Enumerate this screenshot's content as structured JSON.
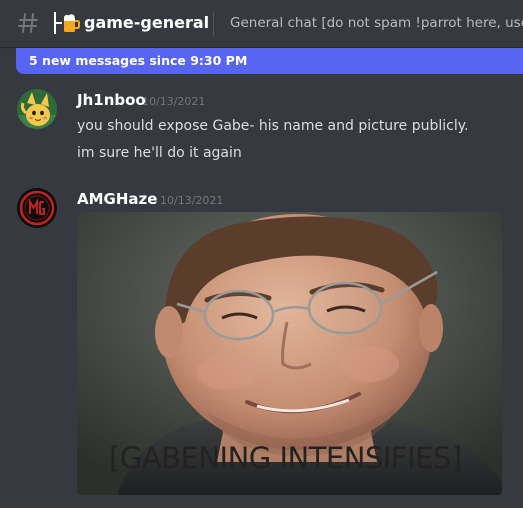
{
  "header": {
    "channel_name": "game-general",
    "topic": "General chat [do not spam !parrot here, use #p",
    "channel_icon": "hash-icon",
    "emoji_icon": "beer-mug-icon"
  },
  "new_messages_bar": {
    "text": "5 new messages since 9:30 PM"
  },
  "messages": [
    {
      "author": "Jh1nboo",
      "timestamp": "10/13/2021",
      "lines": [
        "you should expose Gabe- his name and picture publicly.",
        "im sure he'll do it again"
      ],
      "avatar_icon": "yellow-cartoon-avatar"
    },
    {
      "author": "AMGHaze",
      "timestamp": "10/13/2021",
      "avatar_icon": "amg-logo-avatar",
      "attachment": {
        "caption": "[GABENING INTENSIFIES]",
        "icon": "man-with-glasses-photo"
      }
    }
  ],
  "colors": {
    "background": "#36393f",
    "accent": "#5865f2",
    "author": "#ffffff",
    "text": "#dcddde",
    "muted": "#72767d"
  }
}
